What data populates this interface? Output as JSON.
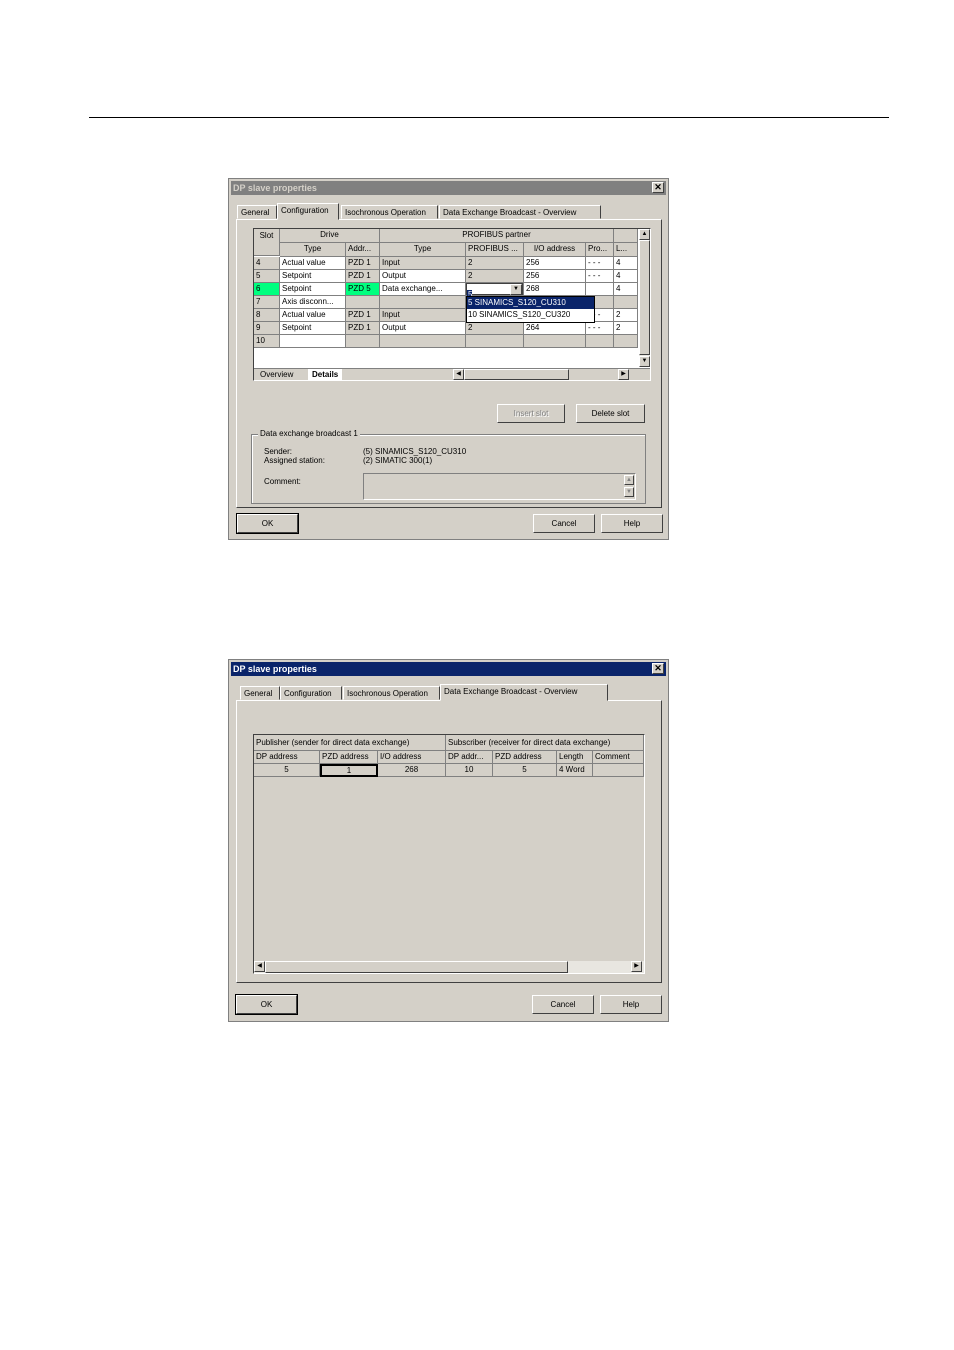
{
  "dialog1": {
    "title": "DP slave properties",
    "tabs": [
      "General",
      "Configuration",
      "Isochronous Operation",
      "Data Exchange Broadcast - Overview"
    ],
    "active_tab": "Configuration",
    "table": {
      "header_slot": "Slot",
      "header_drive": "Drive",
      "header_partner": "PROFIBUS partner",
      "sub_type": "Type",
      "sub_addr": "Addr...",
      "sub_ptype": "Type",
      "sub_profibus": "PROFIBUS ...",
      "sub_io": "I/O address",
      "sub_pro": "Pro...",
      "sub_l": "L...",
      "rows": [
        {
          "slot": "4",
          "type": "Actual value",
          "addr": "PZD 1",
          "ptype": "Input",
          "profibus": "2",
          "io": "256",
          "pro": "- - -",
          "l": "4"
        },
        {
          "slot": "5",
          "type": "Setpoint",
          "addr": "PZD 1",
          "ptype": "Output",
          "profibus": "2",
          "io": "256",
          "pro": "- - -",
          "l": "4"
        },
        {
          "slot": "6",
          "type": "Setpoint",
          "addr": "PZD 5",
          "ptype": "Data exchange...",
          "profibus": "5",
          "io": "268",
          "pro": "",
          "l": "4"
        },
        {
          "slot": "7",
          "type": "Axis disconn...",
          "addr": "",
          "ptype": "",
          "profibus": "",
          "io": "",
          "pro": "",
          "l": ""
        },
        {
          "slot": "8",
          "type": "Actual value",
          "addr": "PZD 1",
          "ptype": "Input",
          "profibus": "",
          "io": "",
          "pro": "- - -",
          "l": "2"
        },
        {
          "slot": "9",
          "type": "Setpoint",
          "addr": "PZD 1",
          "ptype": "Output",
          "profibus": "2",
          "io": "264",
          "pro": "- - -",
          "l": "2"
        },
        {
          "slot": "10",
          "type": "",
          "addr": "",
          "ptype": "",
          "profibus": "",
          "io": "",
          "pro": "",
          "l": ""
        }
      ],
      "dropdown_options": [
        "5   SINAMICS_S120_CU310",
        "10 SINAMICS_S120_CU320"
      ]
    },
    "subtabs": [
      "Overview",
      "Details"
    ],
    "insert_slot": "Insert slot",
    "delete_slot": "Delete slot",
    "group_title": "Data exchange broadcast 1",
    "sender_label": "Sender:",
    "sender_value": "(5) SINAMICS_S120_CU310",
    "assigned_label": "Assigned station:",
    "assigned_value": "(2) SIMATIC 300(1)",
    "comment_label": "Comment:",
    "ok": "OK",
    "cancel": "Cancel",
    "help": "Help"
  },
  "dialog2": {
    "title": "DP slave properties",
    "tabs": [
      "General",
      "Configuration",
      "Isochronous Operation",
      "Data Exchange Broadcast - Overview"
    ],
    "active_tab": "Data Exchange Broadcast - Overview",
    "publisher_header": "Publisher (sender for direct data exchange)",
    "subscriber_header": "Subscriber (receiver for direct data exchange)",
    "columns": [
      "DP address",
      "PZD address",
      "I/O address",
      "DP addr...",
      "PZD address",
      "Length",
      "Comment"
    ],
    "row": [
      "5",
      "1",
      "268",
      "10",
      "5",
      "4 Word",
      ""
    ],
    "ok": "OK",
    "cancel": "Cancel",
    "help": "Help"
  }
}
